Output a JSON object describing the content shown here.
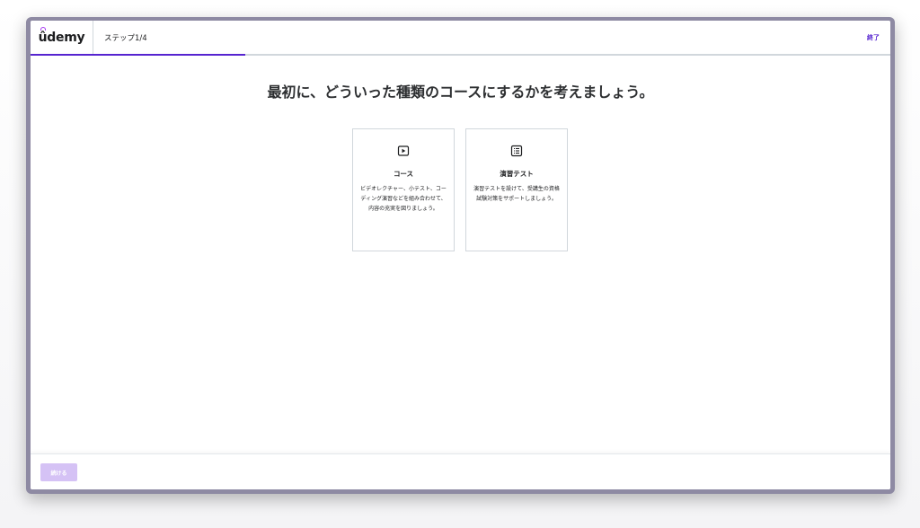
{
  "header": {
    "logo_text": "ûdemy",
    "step_label": "ステップ1/4",
    "exit_label": "終了",
    "progress": {
      "current": 1,
      "total": 4
    }
  },
  "main": {
    "title": "最初に、どういった種類のコースにするかを考えましょう。",
    "cards": [
      {
        "icon": "video-play-icon",
        "title": "コース",
        "description": "ビデオレクチャー、小テスト、コーディング演習などを組み合わせて、内容の充実を図りましょう。"
      },
      {
        "icon": "list-document-icon",
        "title": "演習テスト",
        "description": "演習テストを設けて、受講生の資格試験対策をサポートしましょう。"
      }
    ]
  },
  "footer": {
    "continue_label": "続ける"
  },
  "colors": {
    "accent": "#5624d0",
    "logo_accent": "#a435f0",
    "disabled_button": "#d5c2f5",
    "border": "#d1d7dc",
    "window_frame": "#8e8aa3"
  }
}
